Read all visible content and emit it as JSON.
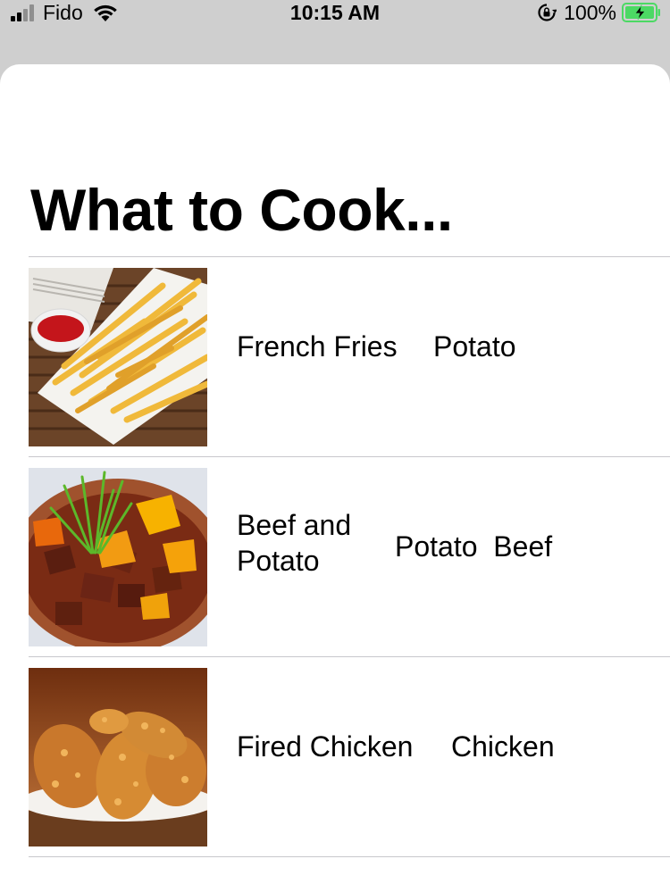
{
  "status_bar": {
    "carrier": "Fido",
    "time": "10:15 AM",
    "battery_percent": "100%",
    "battery_color": "#4cd964"
  },
  "page": {
    "title": "What to Cook..."
  },
  "recipes": [
    {
      "name": "French Fries",
      "ingredients": "Potato",
      "image": "french-fries"
    },
    {
      "name": "Beef and\nPotato",
      "ingredients": "Potato  Beef",
      "image": "beef-potato-stew"
    },
    {
      "name": "Fired Chicken",
      "ingredients": "Chicken",
      "image": "fried-chicken"
    }
  ]
}
